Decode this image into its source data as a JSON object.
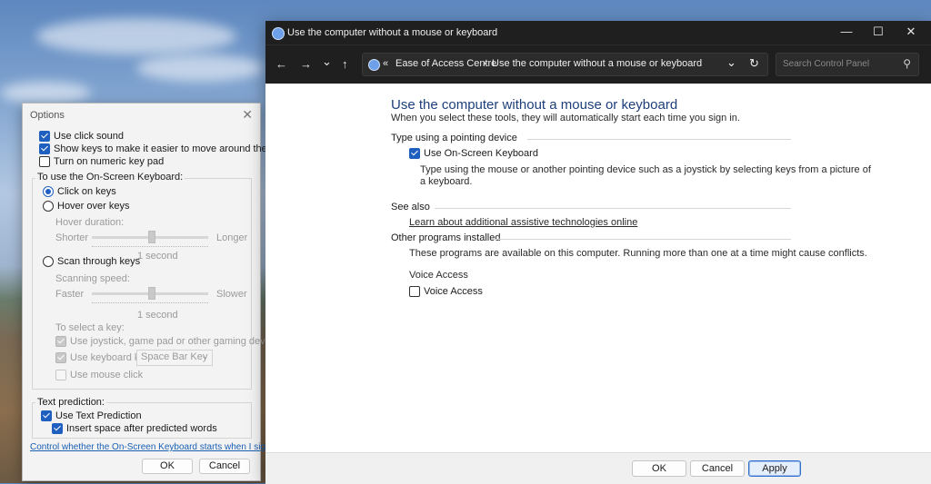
{
  "options_dialog": {
    "title": "Options",
    "close_glyph": "✕",
    "top_checks": [
      {
        "label": "Use click sound",
        "checked": true
      },
      {
        "label": "Show keys to make it easier to move around the screen",
        "checked": true
      },
      {
        "label": "Turn on numeric key pad",
        "checked": false
      }
    ],
    "osk_group_label": "To use the On-Screen Keyboard:",
    "click_on_keys": "Click on keys",
    "hover_over_keys": "Hover over keys",
    "hover_duration": "Hover duration:",
    "shorter": "Shorter",
    "longer": "Longer",
    "hover_value": "1 second",
    "scan_through_keys": "Scan through keys",
    "scanning_speed": "Scanning speed:",
    "faster": "Faster",
    "slower": "Slower",
    "scan_value": "1 second",
    "select_key_label": "To select a key:",
    "use_joystick": "Use joystick, game pad or other gaming device",
    "use_keyboard_key": "Use keyboard key",
    "keyboard_key_value": "Space Bar Key",
    "use_mouse_click": "Use mouse click",
    "text_prediction_label": "Text prediction:",
    "use_text_prediction": "Use Text Prediction",
    "insert_space": "Insert space after predicted words",
    "control_link": "Control whether the On-Screen Keyboard starts when I sign in",
    "ok": "OK",
    "cancel": "Cancel"
  },
  "window": {
    "title": "Use the computer without a mouse or keyboard",
    "minimize": "—",
    "maximize": "☐",
    "close": "✕",
    "nav": {
      "back": "←",
      "forward": "→",
      "recent": "⌄",
      "up": "↑"
    },
    "breadcrumb": {
      "chevrons": "«",
      "parent": "Ease of Access Centre",
      "sep": "›",
      "current": "Use the computer without a mouse or keyboard"
    },
    "dropdown_glyph": "⌄",
    "refresh_glyph": "↻",
    "search_placeholder": "Search Control Panel",
    "search_glyph": "⚲",
    "heading": "Use the computer without a mouse or keyboard",
    "subheading": "When you select these tools, they will automatically start each time you sign in.",
    "section_pointing": "Type using a pointing device",
    "use_osk": "Use On-Screen Keyboard",
    "osk_desc_1": "Type using the mouse or another pointing device such as a joystick by selecting keys from a picture of",
    "osk_desc_2": "a keyboard.",
    "section_see_also": "See also",
    "learn_link": "Learn about additional assistive technologies online",
    "section_other": "Other programs installed",
    "other_desc": "These programs are available on this computer. Running more than one at a time might cause conflicts.",
    "voice_access_heading": "Voice Access",
    "voice_access_check": "Voice Access",
    "footer": {
      "ok": "OK",
      "cancel": "Cancel",
      "apply": "Apply"
    }
  }
}
